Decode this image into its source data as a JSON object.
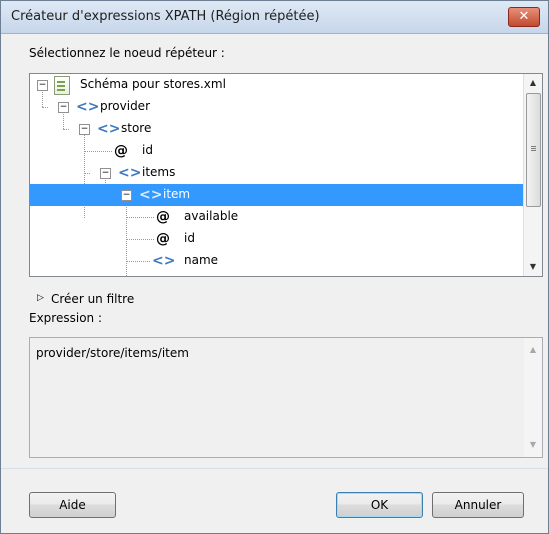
{
  "window": {
    "title": "Créateur d'expressions XPATH (Région répétée)",
    "close_label": "✕"
  },
  "labels": {
    "select_node": "Sélectionnez le noeud répéteur :",
    "filter": "Créer un filtre",
    "expression": "Expression :"
  },
  "tree": {
    "rows": [
      {
        "text": "Schéma pour stores.xml",
        "kind": "file",
        "expander": "−"
      },
      {
        "text": "provider",
        "kind": "element",
        "expander": "−"
      },
      {
        "text": "store",
        "kind": "element",
        "expander": "−"
      },
      {
        "text": "id",
        "kind": "attribute"
      },
      {
        "text": "items",
        "kind": "element",
        "expander": "−"
      },
      {
        "text": "item",
        "kind": "element",
        "expander": "−",
        "selected": true
      },
      {
        "text": "available",
        "kind": "attribute"
      },
      {
        "text": "id",
        "kind": "attribute"
      },
      {
        "text": "name",
        "kind": "element"
      }
    ]
  },
  "expression": {
    "value": "provider/store/items/item"
  },
  "buttons": {
    "help": "Aide",
    "ok": "OK",
    "cancel": "Annuler"
  },
  "colors": {
    "selection": "#3399ff",
    "accent": "#3b78c4"
  },
  "icons": {
    "scroll_up": "▲",
    "scroll_down": "▼",
    "filter_toggle": "▷"
  }
}
